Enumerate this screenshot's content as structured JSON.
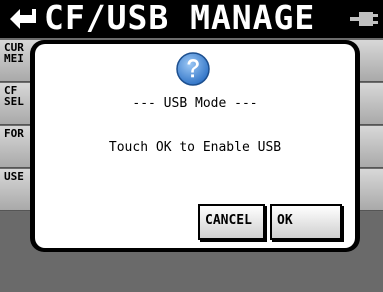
{
  "header": {
    "title": "CF/USB MANAGE",
    "back_icon": "return-arrow-icon",
    "device_icon": "usb-plug-icon"
  },
  "side_menu": {
    "items": [
      {
        "label": "CUR\nMEI"
      },
      {
        "label": "CF\nSEL"
      },
      {
        "label": "FOR"
      },
      {
        "label": "USE"
      }
    ]
  },
  "dialog": {
    "icon": "question-icon",
    "heading": "--- USB Mode ---",
    "message": "Touch OK to Enable USB",
    "cancel_label": "CANCEL",
    "ok_label": "OK"
  },
  "colors": {
    "title_bar": "#000000",
    "dialog_bg": "#ffffff",
    "help_icon": "#3b7fd0"
  }
}
